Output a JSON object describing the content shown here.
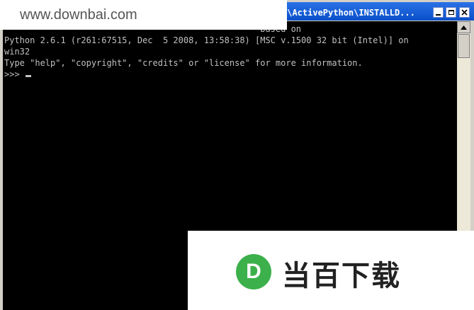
{
  "window": {
    "title": "s\\ActivePython\\INSTALLD...",
    "accent": "#0a4fc9"
  },
  "console": {
    "lines": [
      "                                                  based on",
      "Python 2.6.1 (r261:67515, Dec  5 2008, 13:58:38) [MSC v.1500 32 bit (Intel)] on",
      "win32",
      "Type \"help\", \"copyright\", \"credits\" or \"license\" for more information."
    ],
    "prompt": ">>>"
  },
  "watermark": {
    "site": "www.downbai.com",
    "logo_letter": "D",
    "brand": "当百下载",
    "logo_color": "#3cb04a"
  }
}
